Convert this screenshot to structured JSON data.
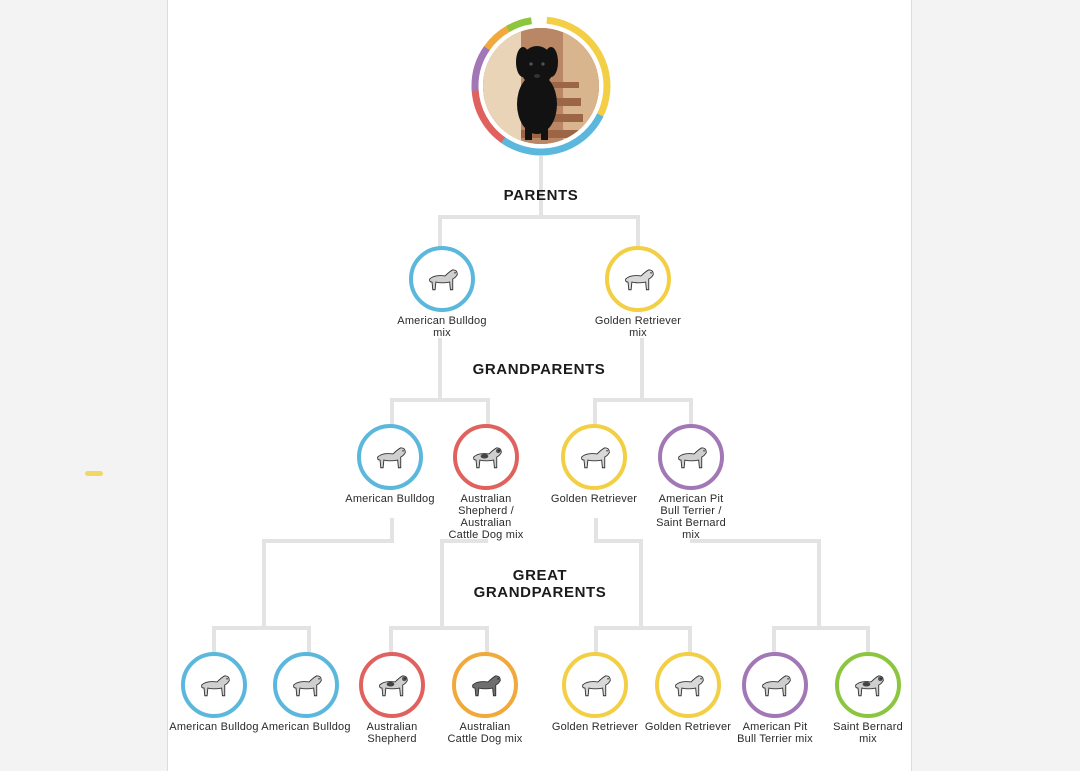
{
  "sections": {
    "parents": "PARENTS",
    "grandparents": "GRANDPARENTS",
    "great_line1": "GREAT",
    "great_line2": "GRANDPARENTS"
  },
  "colors": {
    "blue": "#5bb8dc",
    "yellow": "#f2cf45",
    "red": "#e0625f",
    "orange": "#f0a93a",
    "purple": "#a277b6",
    "green": "#8cc63f",
    "line": "#e3e3e3"
  },
  "parents": [
    {
      "label_l1": "American Bulldog",
      "label_l2": "mix",
      "color": "blue",
      "breed_icon": "bulldog-icon"
    },
    {
      "label_l1": "Golden Retriever",
      "label_l2": "mix",
      "color": "yellow",
      "breed_icon": "retriever-icon"
    }
  ],
  "grandparents": [
    {
      "lines": [
        "American Bulldog"
      ],
      "color": "blue",
      "breed_icon": "bulldog-icon"
    },
    {
      "lines": [
        "Australian",
        "Shepherd /",
        "Australian",
        "Cattle Dog mix"
      ],
      "color": "red",
      "breed_icon": "shepherd-icon"
    },
    {
      "lines": [
        "Golden Retriever"
      ],
      "color": "yellow",
      "breed_icon": "retriever-icon"
    },
    {
      "lines": [
        "American Pit",
        "Bull Terrier /",
        "Saint Bernard",
        "mix"
      ],
      "color": "purple",
      "breed_icon": "pitbull-icon"
    }
  ],
  "great_grandparents": [
    {
      "lines": [
        "American Bulldog"
      ],
      "color": "blue",
      "breed_icon": "bulldog-icon"
    },
    {
      "lines": [
        "American Bulldog"
      ],
      "color": "blue",
      "breed_icon": "bulldog-icon"
    },
    {
      "lines": [
        "Australian",
        "Shepherd"
      ],
      "color": "red",
      "breed_icon": "shepherd-icon"
    },
    {
      "lines": [
        "Australian",
        "Cattle Dog mix"
      ],
      "color": "orange",
      "breed_icon": "cattle-dog-icon"
    },
    {
      "lines": [
        "Golden Retriever"
      ],
      "color": "yellow",
      "breed_icon": "retriever-icon"
    },
    {
      "lines": [
        "Golden Retriever"
      ],
      "color": "yellow",
      "breed_icon": "retriever-icon"
    },
    {
      "lines": [
        "American Pit",
        "Bull Terrier mix"
      ],
      "color": "purple",
      "breed_icon": "pitbull-icon"
    },
    {
      "lines": [
        "Saint Bernard",
        "mix"
      ],
      "color": "green",
      "breed_icon": "saint-bernard-icon"
    }
  ]
}
